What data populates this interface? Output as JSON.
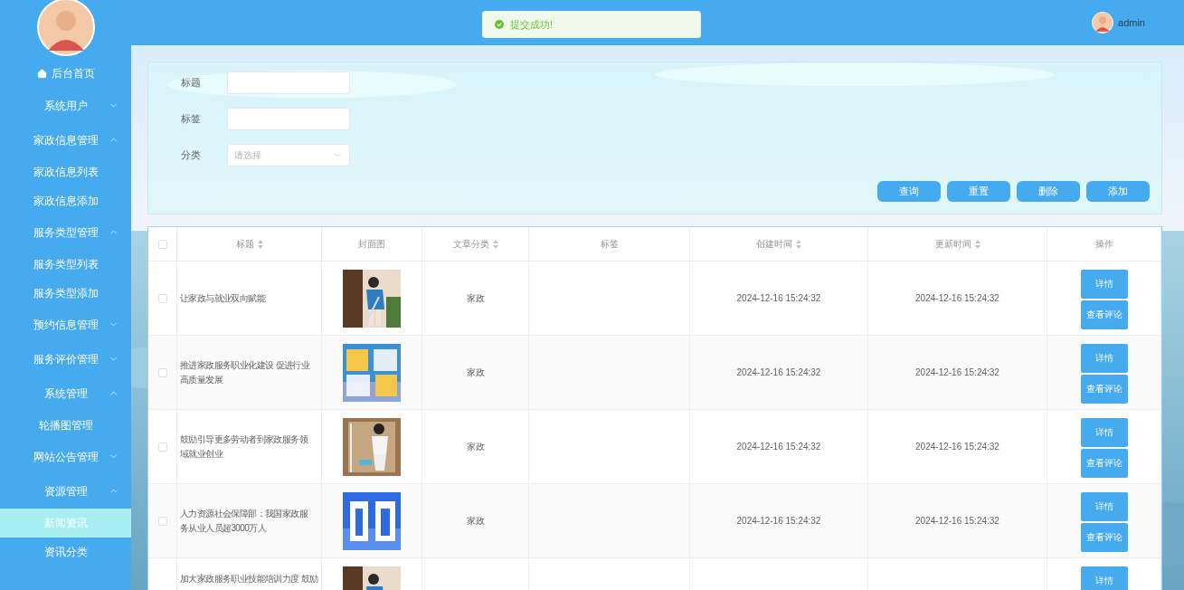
{
  "sidebar": {
    "home": "后台首页",
    "menu": [
      {
        "label": "系统用户",
        "expanded": false
      },
      {
        "label": "家政信息管理",
        "expanded": true,
        "children": [
          {
            "label": "家政信息列表",
            "selected": false
          },
          {
            "label": "家政信息添加",
            "selected": false
          }
        ]
      },
      {
        "label": "服务类型管理",
        "expanded": true,
        "children": [
          {
            "label": "服务类型列表",
            "selected": false
          },
          {
            "label": "服务类型添加",
            "selected": false
          }
        ]
      },
      {
        "label": "预约信息管理",
        "expanded": false
      },
      {
        "label": "服务评价管理",
        "expanded": false
      },
      {
        "label": "系统管理",
        "expanded": true,
        "children": [
          {
            "label": "轮播图管理",
            "selected": false
          }
        ]
      },
      {
        "label": "网站公告管理",
        "expanded": false
      },
      {
        "label": "资源管理",
        "expanded": true,
        "children": [
          {
            "label": "新闻资讯",
            "selected": true
          },
          {
            "label": "资讯分类",
            "selected": false
          }
        ]
      }
    ]
  },
  "header": {
    "user": "admin"
  },
  "toast": {
    "kind": "success",
    "text": "提交成功!"
  },
  "search": {
    "fields": [
      {
        "label": "标题",
        "kind": "input"
      },
      {
        "label": "标签",
        "kind": "input"
      },
      {
        "label": "分类",
        "kind": "select",
        "placeholder": "请选择"
      }
    ],
    "buttons": [
      "查询",
      "重置",
      "删除",
      "添加"
    ]
  },
  "table": {
    "all_checked": false,
    "columns": [
      {
        "label": "标题",
        "sortable": true
      },
      {
        "label": "封面图",
        "sortable": false
      },
      {
        "label": "文章分类",
        "sortable": true
      },
      {
        "label": "标签",
        "sortable": false
      },
      {
        "label": "创建时间",
        "sortable": true
      },
      {
        "label": "更新时间",
        "sortable": true
      },
      {
        "label": "操作",
        "sortable": false
      }
    ],
    "rows": [
      {
        "checked": false,
        "title": "让家政与就业双向赋能",
        "cover": {
          "kind": "picture"
        },
        "category": "家政",
        "created": "2024-12-16 15:24:32",
        "updated": "2024-12-16 15:24:32",
        "actions": [
          "详情",
          "查看评论"
        ]
      },
      {
        "checked": false,
        "title": "推进家政服务职业化建设 促进行业高质量发展",
        "cover": {
          "kind": "picture"
        },
        "category": "家政",
        "created": "2024-12-16 15:24:32",
        "updated": "2024-12-16 15:24:32",
        "actions": [
          "详情",
          "查看评论"
        ]
      },
      {
        "checked": false,
        "title": "鼓励引导更多劳动者到家政服务领域就业创业",
        "cover": {
          "kind": "picture"
        },
        "category": "家政",
        "created": "2024-12-16 15:24:32",
        "updated": "2024-12-16 15:24:32",
        "actions": [
          "详情",
          "查看评论"
        ]
      },
      {
        "checked": false,
        "title": "人力资源社会保障部：我国家政服务从业人员超3000万人",
        "cover": {
          "kind": "picture"
        },
        "category": "家政",
        "created": "2024-12-16 15:24:32",
        "updated": "2024-12-16 15:24:32",
        "actions": [
          "详情",
          "查看评论"
        ]
      },
      {
        "title": "加大家政服务职业技能培训力度 鼓励",
        "cover": {
          "kind": "picture"
        },
        "actions": [
          "详情"
        ]
      }
    ]
  }
}
